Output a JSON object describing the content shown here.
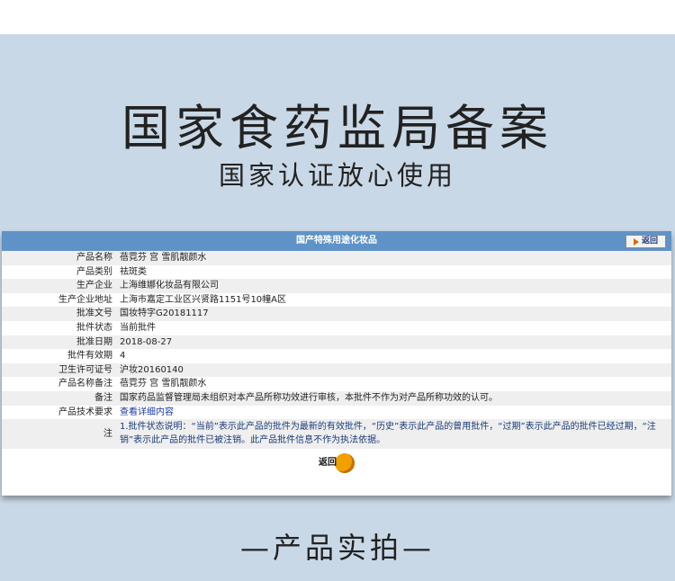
{
  "headline": "国家食药监局备案",
  "subheadline": "国家认证放心使用",
  "panel": {
    "header_title": "国产特殊用途化妆品",
    "back_top_label": "返回",
    "rows": [
      {
        "label": "产品名称",
        "value": "蓓霓芬 宫 雪肌靓颜水"
      },
      {
        "label": "产品类别",
        "value": "祛斑类"
      },
      {
        "label": "生产企业",
        "value": "上海维娜化妆品有限公司"
      },
      {
        "label": "生产企业地址",
        "value": "上海市嘉定工业区兴贤路1151号10幢A区"
      },
      {
        "label": "批准文号",
        "value": "国妆特字G20181117"
      },
      {
        "label": "批件状态",
        "value": "当前批件"
      },
      {
        "label": "批准日期",
        "value": "2018-08-27"
      },
      {
        "label": "批件有效期",
        "value": "4"
      },
      {
        "label": "卫生许可证号",
        "value": "沪妆20160140"
      },
      {
        "label": "产品名称备注",
        "value": "蓓霓芬 宫 雪肌靓颜水"
      },
      {
        "label": "备注",
        "value": "国家药品监督管理局未组织对本产品所称功效进行审核，本批件不作为对产品所称功效的认可。"
      },
      {
        "label": "产品技术要求",
        "value": "查看详细内容"
      },
      {
        "label": "注",
        "value": "1.批件状态说明：“当前”表示此产品的批件为最新的有效批件，“历史”表示此产品的曾用批件，“过期”表示此产品的批件已经过期，“注销”表示此产品的批件已被注销。此产品批件信息不作为执法依据。"
      }
    ],
    "back_bottom_label": "返回"
  },
  "footer": "—产品实拍—"
}
